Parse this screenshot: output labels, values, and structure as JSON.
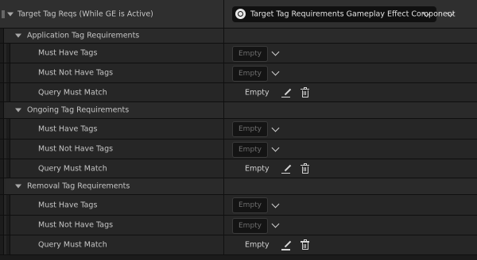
{
  "property": {
    "label": "Target Tag Reqs (While GE is Active)",
    "component_label": "Target Tag Requirements Gameplay Effect Component"
  },
  "groups": [
    {
      "label": "Application Tag Requirements",
      "must_have": {
        "label": "Must Have Tags",
        "value": "Empty"
      },
      "must_not_have": {
        "label": "Must Not Have Tags",
        "value": "Empty"
      },
      "query": {
        "label": "Query Must Match",
        "value": "Empty"
      }
    },
    {
      "label": "Ongoing Tag Requirements",
      "must_have": {
        "label": "Must Have Tags",
        "value": "Empty"
      },
      "must_not_have": {
        "label": "Must Not Have Tags",
        "value": "Empty"
      },
      "query": {
        "label": "Query Must Match",
        "value": "Empty"
      }
    },
    {
      "label": "Removal Tag Requirements",
      "must_have": {
        "label": "Must Have Tags",
        "value": "Empty"
      },
      "must_not_have": {
        "label": "Must Not Have Tags",
        "value": "Empty"
      },
      "query": {
        "label": "Query Must Match",
        "value": "Empty"
      }
    }
  ],
  "icons": {
    "grip": "drag-handle-icon",
    "expand": "caret-down-icon",
    "component": "component-icon",
    "dropdown": "chevron-down-icon",
    "edit": "pencil-icon",
    "delete": "trash-icon"
  }
}
